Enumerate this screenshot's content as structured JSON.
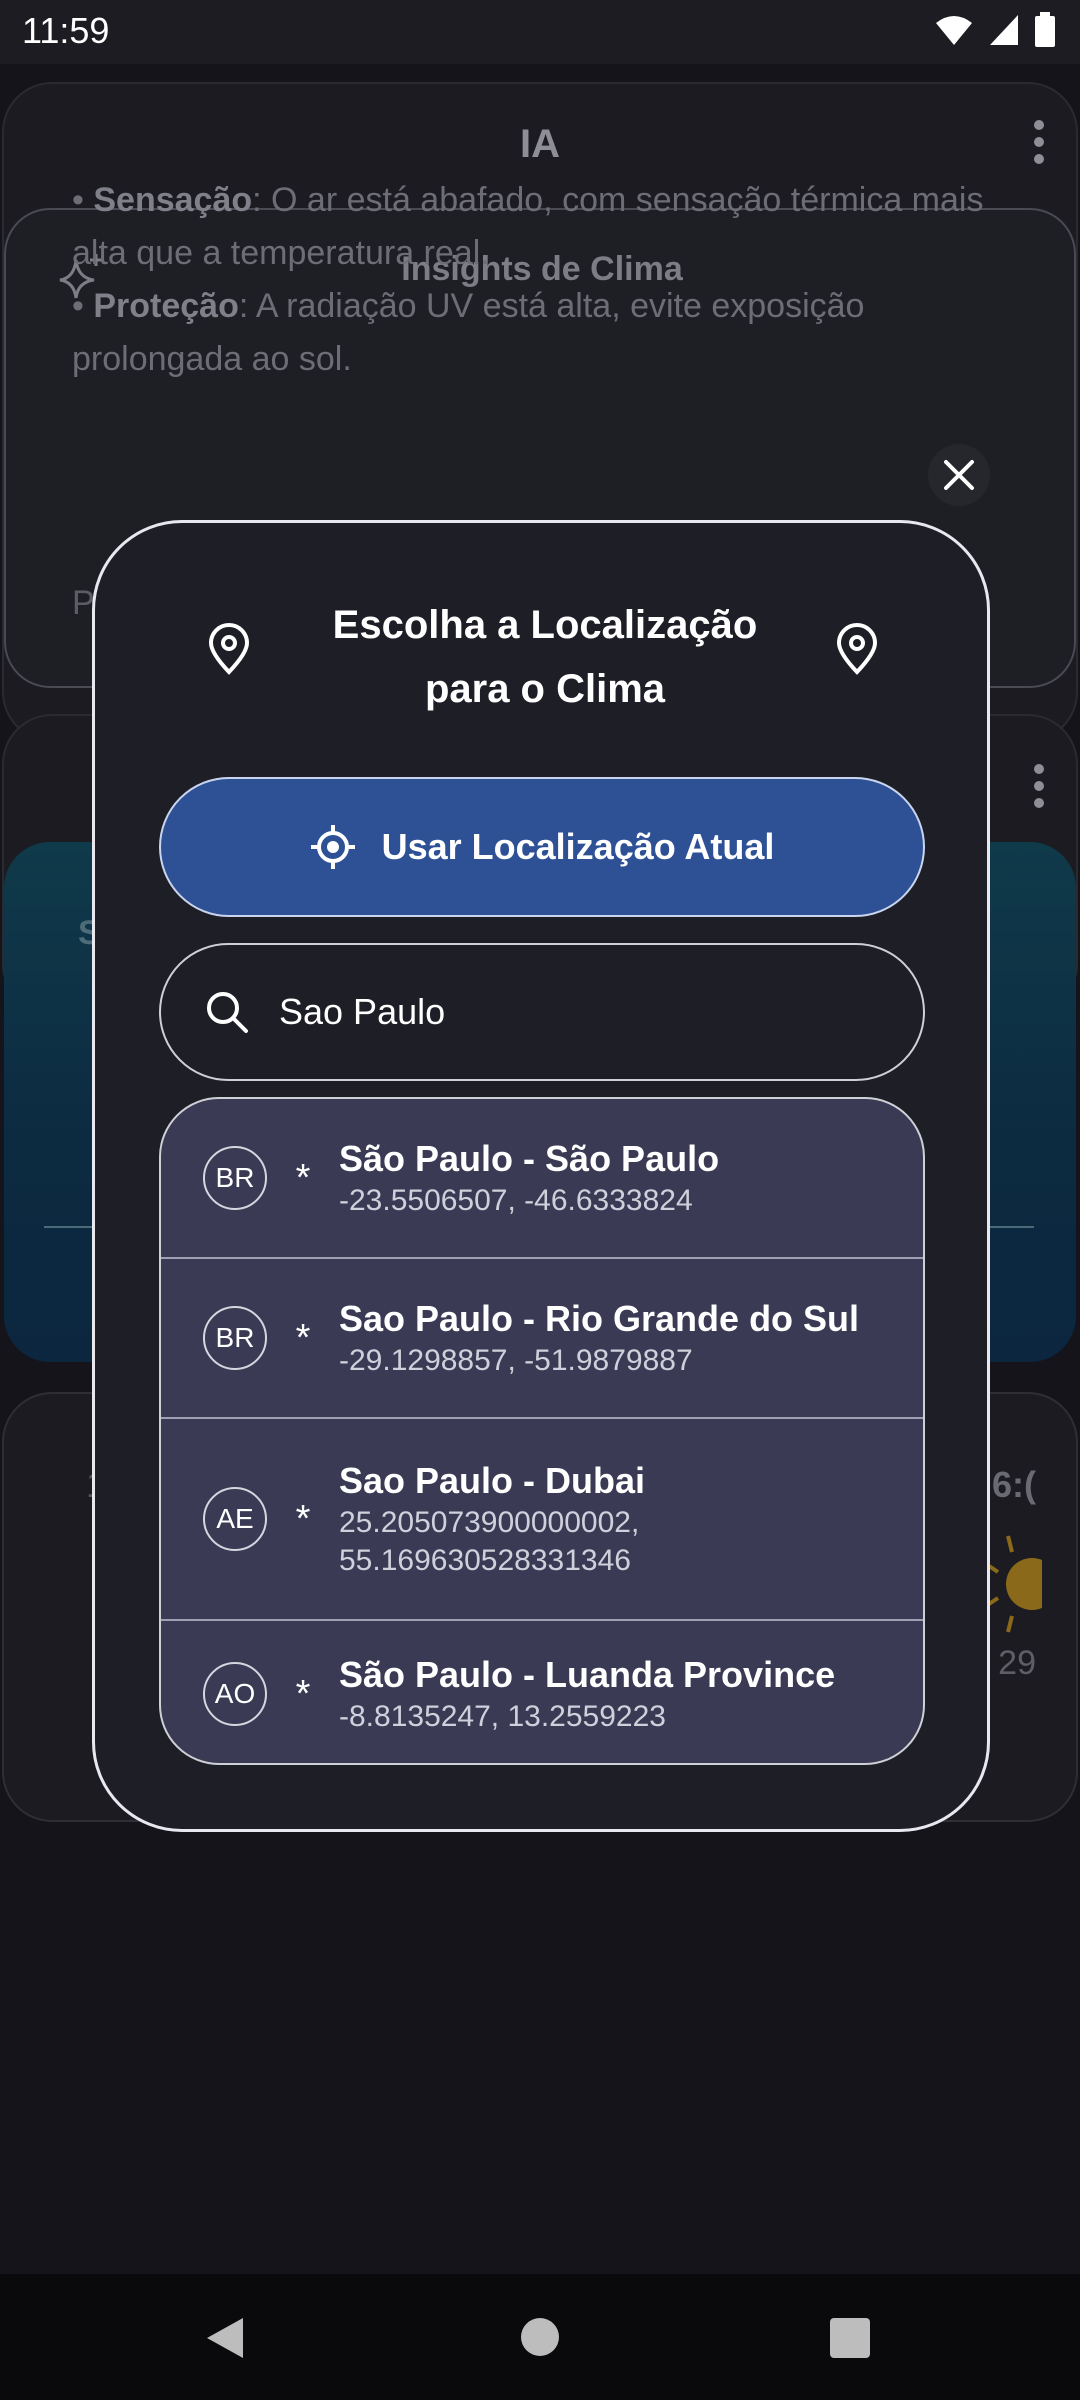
{
  "status_bar": {
    "time": "11:59"
  },
  "app_bar": {
    "title": "IA"
  },
  "insights": {
    "title": "Insights de Clima",
    "line1_label": "Sensação",
    "line1_text": ": O ar está abafado, com sensação térmica mais alta que a temperatura real.",
    "line2_label": "Proteção",
    "line2_text": ": A radiação UV está alta, evite exposição prolongada ao sol.",
    "partial": "P"
  },
  "background": {
    "teal_partial": "S",
    "card3_partial": "6:(",
    "card3_value": "29",
    "card3_left": "1"
  },
  "modal": {
    "title": "Escolha a Localização para o Clima",
    "use_location_label": "Usar Localização Atual",
    "search_value": "Sao Paulo",
    "results": [
      {
        "code": "BR",
        "name": "São Paulo - São Paulo",
        "coords": "-23.5506507, -46.6333824"
      },
      {
        "code": "BR",
        "name": "Sao Paulo - Rio Grande do Sul",
        "coords": "-29.1298857, -51.9879887"
      },
      {
        "code": "AE",
        "name": "Sao Paulo - Dubai",
        "coords": "25.205073900000002, 55.169630528331346"
      },
      {
        "code": "AO",
        "name": "São Paulo - Luanda Province",
        "coords": "-8.8135247, 13.2559223"
      }
    ],
    "star_glyph": "*"
  },
  "colors": {
    "accent": "#2e5196",
    "list_bg": "#3a3a54",
    "modal_bg": "#1e1e26"
  }
}
